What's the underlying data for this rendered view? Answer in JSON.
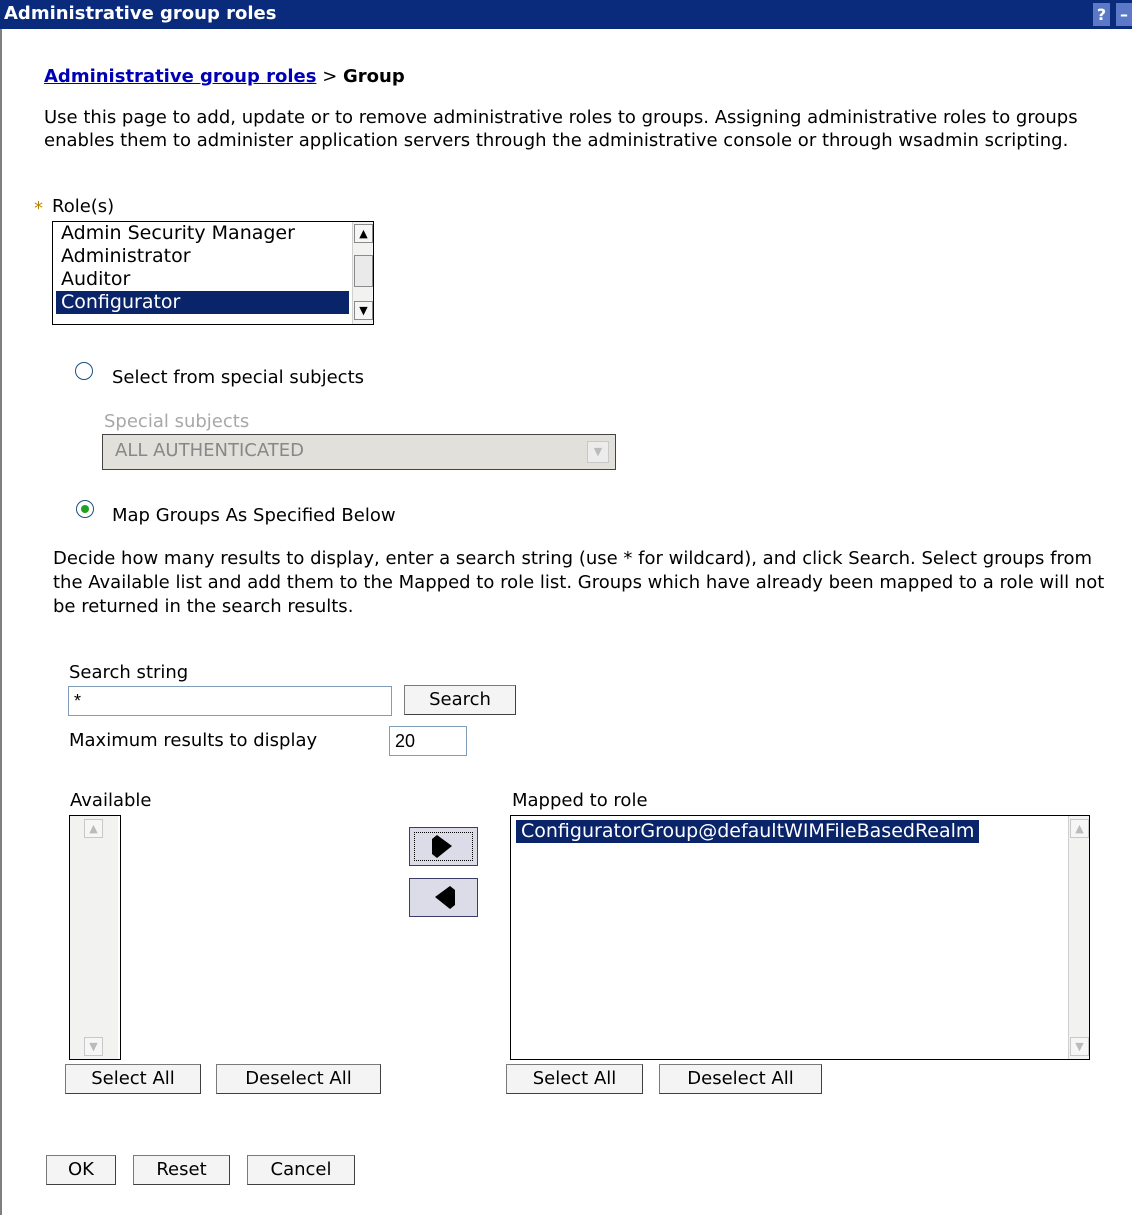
{
  "window": {
    "title": "Administrative group roles",
    "help_label": "?",
    "minimize_label": "–"
  },
  "breadcrumb": {
    "link": "Administrative group roles",
    "separator": " > ",
    "current": "Group"
  },
  "description": "Use this page to add, update or to remove administrative roles to groups. Assigning administrative roles to groups enables them to administer application servers through the administrative console or through wsadmin scripting.",
  "roles": {
    "required_marker": "*",
    "label": "Role(s)",
    "items": [
      "Admin Security Manager",
      "Administrator",
      "Auditor",
      "Configurator"
    ],
    "selected": "Configurator"
  },
  "special_subjects": {
    "radio_label": "Select from special subjects",
    "checked": false,
    "select_label": "Special subjects",
    "select_value": "ALL AUTHENTICATED",
    "disabled": true
  },
  "map_groups": {
    "radio_label": "Map Groups As Specified Below",
    "checked": true,
    "instructions": "Decide how many results to display, enter a search string (use * for wildcard), and click Search. Select groups from the Available list and add them to the Mapped to role list. Groups which have already been mapped to a role will not be returned in the search results."
  },
  "search": {
    "label": "Search string",
    "value": "*",
    "button": "Search",
    "max_label": "Maximum results to display",
    "max_value": "20"
  },
  "available": {
    "label": "Available",
    "items": [],
    "select_all": "Select All",
    "deselect_all": "Deselect All"
  },
  "transfer": {
    "add_icon": "arrow-right-icon",
    "remove_icon": "arrow-left-icon"
  },
  "mapped": {
    "label": "Mapped to role",
    "items": [
      "ConfiguratorGroup@defaultWIMFileBasedRealm"
    ],
    "selected": "ConfiguratorGroup@defaultWIMFileBasedRealm",
    "select_all": "Select All",
    "deselect_all": "Deselect All"
  },
  "actions": {
    "ok": "OK",
    "reset": "Reset",
    "cancel": "Cancel"
  },
  "colors": {
    "title_bar": "#0a2a7c",
    "link": "#0000b7",
    "selection": "#0a246a",
    "required": "#b88400"
  }
}
